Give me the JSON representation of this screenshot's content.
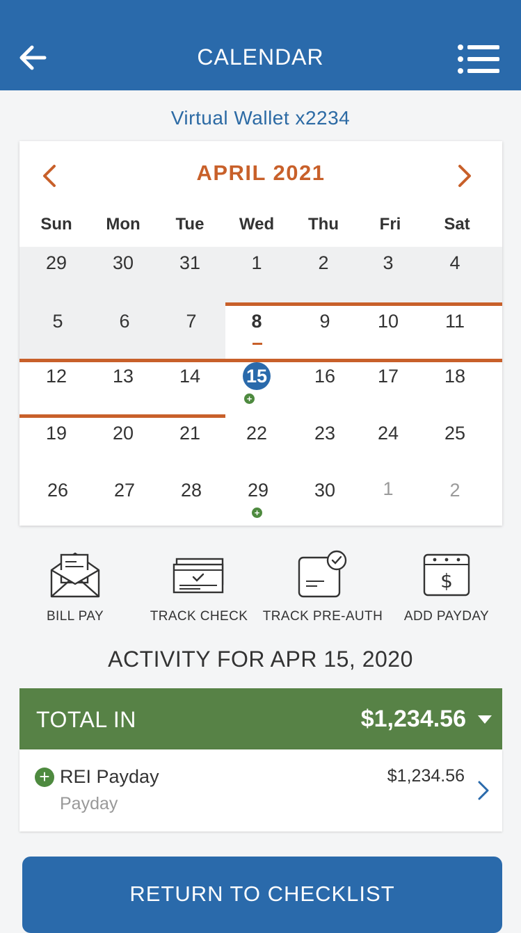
{
  "header": {
    "title": "CALENDAR"
  },
  "account": {
    "name": "Virtual Wallet x2234"
  },
  "calendar": {
    "month_label": "APRIL 2021",
    "weekdays": [
      "Sun",
      "Mon",
      "Tue",
      "Wed",
      "Thu",
      "Fri",
      "Sat"
    ],
    "weeks": [
      [
        "29",
        "30",
        "31",
        "1",
        "2",
        "3",
        "4"
      ],
      [
        "5",
        "6",
        "7",
        "8",
        "9",
        "10",
        "11"
      ],
      [
        "12",
        "13",
        "14",
        "15",
        "16",
        "17",
        "18"
      ],
      [
        "19",
        "20",
        "21",
        "22",
        "23",
        "24",
        "25"
      ],
      [
        "26",
        "27",
        "28",
        "29",
        "30",
        "1",
        "2"
      ]
    ],
    "today": "8",
    "selected": "15",
    "event_dates": [
      "15",
      "29"
    ],
    "accent_color": "#c8602a",
    "selected_color": "#2a6aab",
    "event_color": "#4e8a3f"
  },
  "actions": [
    {
      "label": "BILL PAY",
      "icon": "envelope-bill-icon"
    },
    {
      "label": "TRACK CHECK",
      "icon": "check-icon"
    },
    {
      "label": "TRACK PRE-AUTH",
      "icon": "card-check-icon"
    },
    {
      "label": "ADD PAYDAY",
      "icon": "calendar-dollar-icon"
    }
  ],
  "activity": {
    "title": "ACTIVITY FOR APR 15, 2020",
    "total": {
      "label": "TOTAL IN",
      "amount": "$1,234.56",
      "color": "#578246"
    },
    "transactions": [
      {
        "name": "REI Payday",
        "category": "Payday",
        "amount": "$1,234.56",
        "icon": "plus-circle-icon"
      }
    ]
  },
  "footer": {
    "button_label": "RETURN TO CHECKLIST"
  }
}
